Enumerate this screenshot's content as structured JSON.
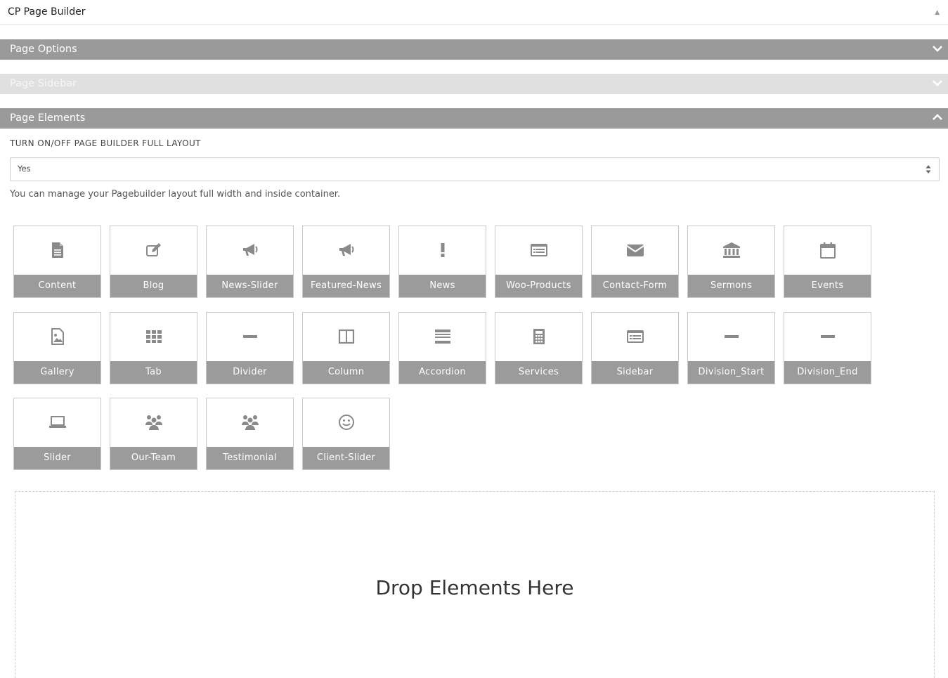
{
  "header": {
    "title": "CP Page Builder"
  },
  "panels": {
    "options": {
      "title": "Page Options"
    },
    "sidebar": {
      "title": "Page Sidebar"
    },
    "elements": {
      "title": "Page Elements"
    }
  },
  "layout_option": {
    "label": "TURN ON/OFF PAGE BUILDER FULL LAYOUT",
    "value": "Yes",
    "description": "You can manage your Pagebuilder layout full width and inside container."
  },
  "elements": [
    {
      "label": "Content",
      "icon": "document-icon"
    },
    {
      "label": "Blog",
      "icon": "edit-icon"
    },
    {
      "label": "News-Slider",
      "icon": "megaphone-icon"
    },
    {
      "label": "Featured-News",
      "icon": "megaphone-icon"
    },
    {
      "label": "News",
      "icon": "exclamation-icon"
    },
    {
      "label": "Woo-Products",
      "icon": "list-box-icon"
    },
    {
      "label": "Contact-Form",
      "icon": "envelope-icon"
    },
    {
      "label": "Sermons",
      "icon": "bank-icon"
    },
    {
      "label": "Events",
      "icon": "calendar-icon"
    },
    {
      "label": "Gallery",
      "icon": "image-file-icon"
    },
    {
      "label": "Tab",
      "icon": "grid-icon"
    },
    {
      "label": "Divider",
      "icon": "minus-icon"
    },
    {
      "label": "Column",
      "icon": "columns-icon"
    },
    {
      "label": "Accordion",
      "icon": "accordion-icon"
    },
    {
      "label": "Services",
      "icon": "calculator-icon"
    },
    {
      "label": "Sidebar",
      "icon": "list-box-icon"
    },
    {
      "label": "Division_Start",
      "icon": "minus-icon"
    },
    {
      "label": "Division_End",
      "icon": "minus-icon"
    },
    {
      "label": "Slider",
      "icon": "laptop-icon"
    },
    {
      "label": "Our-Team",
      "icon": "users-icon"
    },
    {
      "label": "Testimonial",
      "icon": "users-icon"
    },
    {
      "label": "Client-Slider",
      "icon": "smile-icon"
    }
  ],
  "dropzone": {
    "text": "Drop Elements Here"
  }
}
